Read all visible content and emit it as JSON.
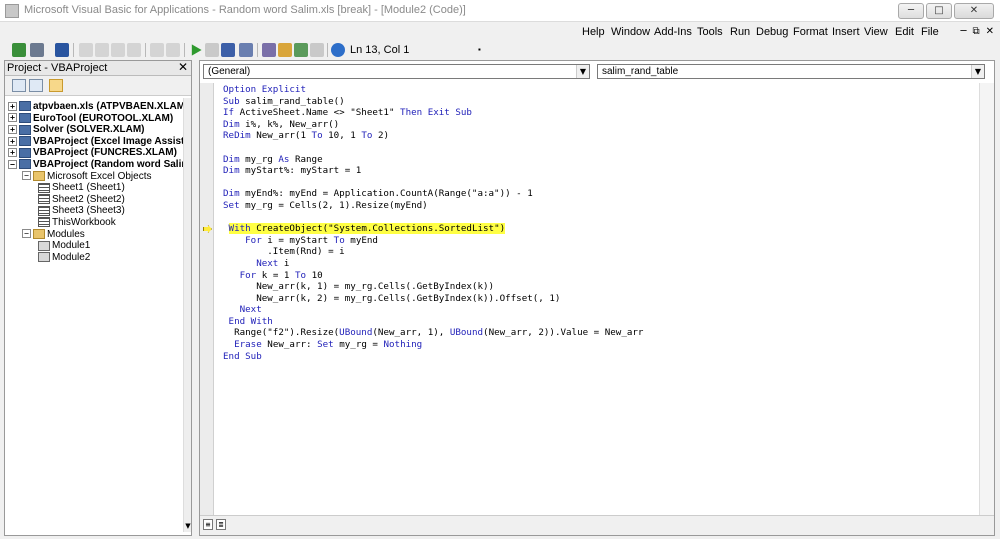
{
  "window": {
    "title": "Microsoft Visual Basic for Applications - Random word Salim.xls [break] - [Module2 (Code)]",
    "min_glyph": "─",
    "max_glyph": "□",
    "close_glyph": "✕"
  },
  "menus": [
    "Help",
    "Window",
    "Add-Ins",
    "Tools",
    "Run",
    "Debug",
    "Format",
    "Insert",
    "View",
    "Edit",
    "File"
  ],
  "mdi_buttons": [
    "─",
    "⧉",
    "✕"
  ],
  "toolbar": {
    "position_text": "Ln 13, Col 1",
    "grip": "▪"
  },
  "project_pane": {
    "title": "Project - VBAProject",
    "close_glyph": "✕",
    "scroll_arrow": "▼",
    "tree": [
      {
        "label": "atpvbaen.xls (ATPVBAEN.XLAM)",
        "expander": "+",
        "icon": "proj",
        "bold": true
      },
      {
        "label": "EuroTool (EUROTOOL.XLAM)",
        "expander": "+",
        "icon": "proj",
        "bold": true
      },
      {
        "label": "Solver (SOLVER.XLAM)",
        "expander": "+",
        "icon": "proj",
        "bold": true
      },
      {
        "label": "VBAProject (Excel Image Assistant.xla",
        "expander": "+",
        "icon": "proj",
        "bold": true
      },
      {
        "label": "VBAProject (FUNCRES.XLAM)",
        "expander": "+",
        "icon": "proj",
        "bold": true
      },
      {
        "label": "VBAProject (Random word Salim.xls)",
        "expander": "−",
        "icon": "proj",
        "bold": true
      },
      {
        "label": "Microsoft Excel Objects",
        "expander": "−",
        "icon": "folder",
        "bold": false
      },
      {
        "label": "Sheet1 (Sheet1)",
        "expander": "",
        "icon": "sheet",
        "bold": false
      },
      {
        "label": "Sheet2 (Sheet2)",
        "expander": "",
        "icon": "sheet",
        "bold": false
      },
      {
        "label": "Sheet3 (Sheet3)",
        "expander": "",
        "icon": "sheet",
        "bold": false
      },
      {
        "label": "ThisWorkbook",
        "expander": "",
        "icon": "sheet",
        "bold": false
      },
      {
        "label": "Modules",
        "expander": "−",
        "icon": "folder",
        "bold": false
      },
      {
        "label": "Module1",
        "expander": "",
        "icon": "mod",
        "bold": false
      },
      {
        "label": "Module2",
        "expander": "",
        "icon": "mod",
        "bold": false
      }
    ]
  },
  "code_window": {
    "object_combo": "(General)",
    "procedure_combo": "salim_rand_table",
    "dropdown_glyph": "▼",
    "view_buttons": [
      "≡",
      "≣"
    ],
    "lines": [
      [
        {
          "t": "Option Explicit",
          "k": true
        }
      ],
      [
        {
          "t": "Sub ",
          "k": true
        },
        {
          "t": "salim_rand_table()"
        }
      ],
      [
        {
          "t": "If ",
          "k": true
        },
        {
          "t": "ActiveSheet.Name <> \"Sheet1\" "
        },
        {
          "t": "Then Exit Sub",
          "k": true
        }
      ],
      [
        {
          "t": "Dim ",
          "k": true
        },
        {
          "t": "i%, k%, New_arr()"
        }
      ],
      [
        {
          "t": "ReDim ",
          "k": true
        },
        {
          "t": "New_arr(1 "
        },
        {
          "t": "To",
          "k": true
        },
        {
          "t": " 10, 1 "
        },
        {
          "t": "To",
          "k": true
        },
        {
          "t": " 2)"
        }
      ],
      [],
      [
        {
          "t": "Dim ",
          "k": true
        },
        {
          "t": "my_rg "
        },
        {
          "t": "As",
          "k": true
        },
        {
          "t": " Range"
        }
      ],
      [
        {
          "t": "Dim ",
          "k": true
        },
        {
          "t": "myStart%: myStart = 1"
        }
      ],
      [],
      [
        {
          "t": "Dim ",
          "k": true
        },
        {
          "t": "myEnd%: myEnd = Application.CountA(Range(\"a:a\")) - 1"
        }
      ],
      [
        {
          "t": "Set ",
          "k": true
        },
        {
          "t": "my_rg = Cells(2, 1).Resize(myEnd)"
        }
      ],
      [],
      [
        {
          "t": " "
        },
        {
          "t": "With ",
          "k": true,
          "h": true
        },
        {
          "t": "CreateObject(\"System.Collections.SortedList\")",
          "h": true
        }
      ],
      [
        {
          "t": "    "
        },
        {
          "t": "For ",
          "k": true
        },
        {
          "t": "i = myStart "
        },
        {
          "t": "To",
          "k": true
        },
        {
          "t": " myEnd"
        }
      ],
      [
        {
          "t": "        .Item(Rnd) = i"
        }
      ],
      [
        {
          "t": "      "
        },
        {
          "t": "Next ",
          "k": true
        },
        {
          "t": "i"
        }
      ],
      [
        {
          "t": "   "
        },
        {
          "t": "For ",
          "k": true
        },
        {
          "t": "k = 1 "
        },
        {
          "t": "To",
          "k": true
        },
        {
          "t": " 10"
        }
      ],
      [
        {
          "t": "      New_arr(k, 1) = my_rg.Cells(.GetByIndex(k))"
        }
      ],
      [
        {
          "t": "      New_arr(k, 2) = my_rg.Cells(.GetByIndex(k)).Offset(, 1)"
        }
      ],
      [
        {
          "t": "   "
        },
        {
          "t": "Next",
          "k": true
        }
      ],
      [
        {
          "t": " "
        },
        {
          "t": "End With",
          "k": true
        }
      ],
      [
        {
          "t": "  Range(\"f2\").Resize("
        },
        {
          "t": "UBound",
          "k": true
        },
        {
          "t": "(New_arr, 1), "
        },
        {
          "t": "UBound",
          "k": true
        },
        {
          "t": "(New_arr, 2)).Value = New_arr"
        }
      ],
      [
        {
          "t": "  "
        },
        {
          "t": "Erase ",
          "k": true
        },
        {
          "t": "New_arr: "
        },
        {
          "t": "Set ",
          "k": true
        },
        {
          "t": "my_rg = "
        },
        {
          "t": "Nothing",
          "k": true
        }
      ],
      [
        {
          "t": "End Sub",
          "k": true
        }
      ]
    ]
  },
  "colors": {
    "keyword": "#1f1fb8",
    "highlight": "#ffff44"
  }
}
